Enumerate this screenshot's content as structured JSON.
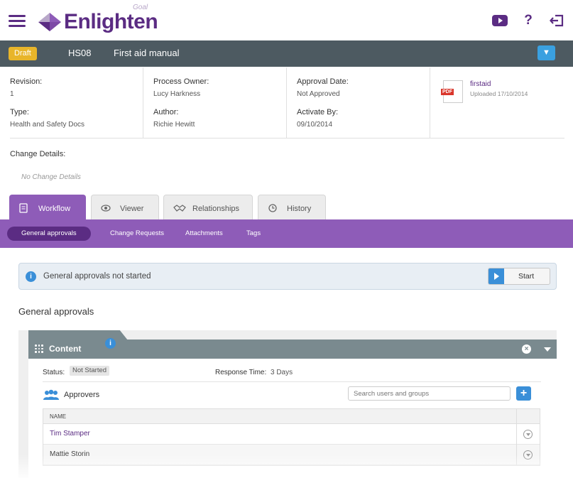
{
  "app": {
    "name": "Enlighten",
    "logo_sub": "Goal"
  },
  "document": {
    "status": "Draft",
    "code": "HS08",
    "title": "First aid manual",
    "toggle_icon": "chevron-down-icon"
  },
  "info": {
    "revision_label": "Revision:",
    "revision_value": "1",
    "type_label": "Type:",
    "type_value": "Health and Safety Docs",
    "owner_label": "Process Owner:",
    "owner_value": "Lucy Harkness",
    "author_label": "Author:",
    "author_value": "Richie Hewitt",
    "approval_label": "Approval Date:",
    "approval_value": "Not Approved",
    "activate_label": "Activate By:",
    "activate_value": "09/10/2014",
    "file": {
      "name": "firstaid",
      "uploaded": "Uploaded 17/10/2014",
      "type_tag": "PDF"
    }
  },
  "change_details": {
    "label": "Change Details:",
    "value": "No Change Details"
  },
  "tabs": [
    {
      "label": "Workflow",
      "icon": "document-icon",
      "active": true
    },
    {
      "label": "Viewer",
      "icon": "eye-icon",
      "active": false
    },
    {
      "label": "Relationships",
      "icon": "handshake-icon",
      "active": false
    },
    {
      "label": "History",
      "icon": "history-icon",
      "active": false
    }
  ],
  "subnav": [
    {
      "label": "General approvals",
      "active": true
    },
    {
      "label": "Change Requests",
      "active": false
    },
    {
      "label": "Attachments",
      "active": false
    },
    {
      "label": "Tags",
      "active": false
    }
  ],
  "alert": {
    "text": "General approvals not started",
    "icon": "info-icon",
    "button": "Start"
  },
  "section_title": "General approvals",
  "panel": {
    "title": "Content",
    "status_label": "Status:",
    "status_value": "Not Started",
    "response_label": "Response Time:",
    "response_value": "3 Days",
    "approvers_label": "Approvers",
    "search_placeholder": "Search users and groups",
    "add_label": "+",
    "table_header": "NAME",
    "rows": [
      {
        "name": "Tim Stamper"
      },
      {
        "name": "Mattie Storin"
      }
    ]
  },
  "colors": {
    "brand": "#5b2c83",
    "accent": "#8e5cb8",
    "docbar": "#4d5a61",
    "draft": "#e8b52a",
    "info_blue": "#3a8fd8"
  }
}
